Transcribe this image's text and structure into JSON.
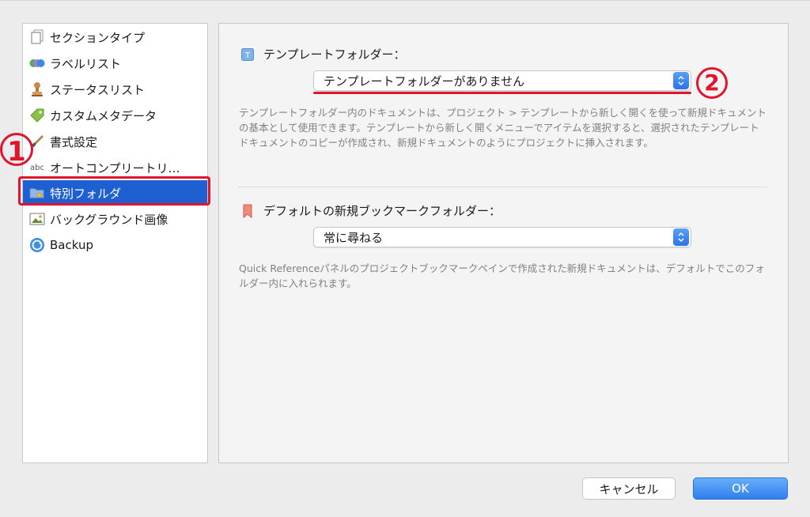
{
  "sidebar": {
    "items": [
      {
        "label": "セクションタイプ",
        "icon": "page-stack-icon"
      },
      {
        "label": "ラベルリスト",
        "icon": "color-circles-icon"
      },
      {
        "label": "ステータスリスト",
        "icon": "stamp-icon"
      },
      {
        "label": "カスタムメタデータ",
        "icon": "tag-icon"
      },
      {
        "label": "書式設定",
        "icon": "brush-icon"
      },
      {
        "label": "オートコンプリートリ…",
        "icon": "abc-icon"
      },
      {
        "label": "特別フォルダ",
        "icon": "folder-star-icon",
        "selected": true
      },
      {
        "label": "バックグラウンド画像",
        "icon": "image-icon"
      },
      {
        "label": "Backup",
        "icon": "backup-icon"
      }
    ]
  },
  "annotations": {
    "marker1": "1",
    "marker2": "2"
  },
  "template_section": {
    "label": "テンプレートフォルダー：",
    "icon_glyph": "T",
    "select_value": "テンプレートフォルダーがありません",
    "description": "テンプレートフォルダー内のドキュメントは、プロジェクト > テンプレートから新しく開くを使って新規ドキュメントの基本として使用できます。テンプレートから新しく開くメニューでアイテムを選択すると、選択されたテンプレートドキュメントのコピーが作成され、新規ドキュメントのようにプロジェクトに挿入されます。"
  },
  "bookmark_section": {
    "label": "デフォルトの新規ブックマークフォルダー：",
    "select_value": "常に尋ねる",
    "description": "Quick Referenceパネルのプロジェクトブックマークペインで作成された新規ドキュメントは、デフォルトでこのフォルダー内に入れられます。"
  },
  "buttons": {
    "cancel": "キャンセル",
    "ok": "OK"
  },
  "colors": {
    "selection": "#1e5fd1",
    "annotation_red": "#e0142c",
    "accent_blue": "#2f7fee"
  }
}
